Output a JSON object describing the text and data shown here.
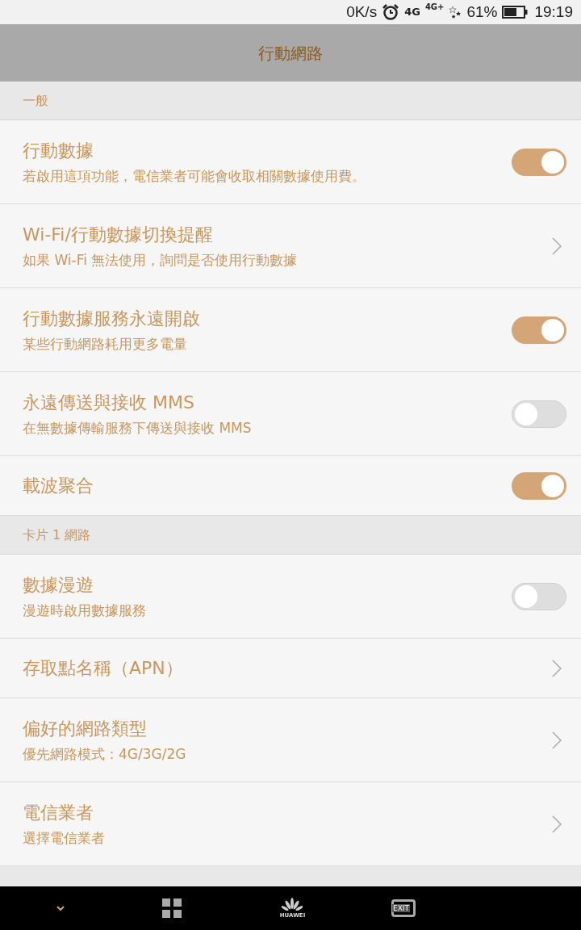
{
  "status_bar": {
    "speed": "0K/s",
    "network": "4G",
    "network2": "4G+",
    "battery": "61%",
    "time": "19:19"
  },
  "title": "行動網路",
  "sections": [
    {
      "header": "一般",
      "rows": [
        {
          "kind": "toggle",
          "title": "行動數據",
          "subtitle": "若啟用這項功能，電信業者可能會收取相關數據使用費。",
          "on": true
        },
        {
          "kind": "link",
          "title": "Wi-Fi/行動數據切換提醒",
          "subtitle": "如果 Wi-Fi 無法使用，詢問是否使用行動數據"
        },
        {
          "kind": "toggle",
          "title": "行動數據服務永遠開啟",
          "subtitle": "某些行動網路耗用更多電量",
          "on": true
        },
        {
          "kind": "toggle",
          "title": "永遠傳送與接收 MMS",
          "subtitle": "在無數據傳輸服務下傳送與接收 MMS",
          "on": false
        },
        {
          "kind": "toggle",
          "title": "載波聚合",
          "on": true
        }
      ]
    },
    {
      "header": "卡片 1 網路",
      "rows": [
        {
          "kind": "toggle",
          "title": "數據漫遊",
          "subtitle": "漫遊時啟用數據服務",
          "on": false
        },
        {
          "kind": "link",
          "title": "存取點名稱（APN）"
        },
        {
          "kind": "link",
          "title": "偏好的網路類型",
          "subtitle": "優先網路模式：4G/3G/2G"
        },
        {
          "kind": "link",
          "title": "電信業者",
          "subtitle": "選擇電信業者"
        }
      ]
    }
  ],
  "nav_bar": {
    "logo_text": "HUAWEI",
    "exit_text": "EXIT"
  }
}
